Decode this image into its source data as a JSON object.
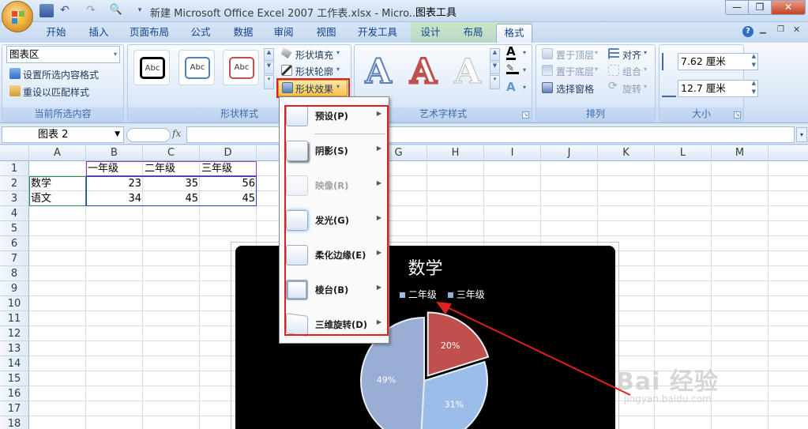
{
  "window": {
    "title": "新建 Microsoft Office Excel 2007 工作表.xlsx - Micro...",
    "context_label": "图表工具",
    "min": "—",
    "restore": "❐",
    "close": "✕"
  },
  "tabs": [
    "开始",
    "插入",
    "页面布局",
    "公式",
    "数据",
    "审阅",
    "视图",
    "开发工具",
    "设计",
    "布局",
    "格式"
  ],
  "active_tab": "格式",
  "ribbon": {
    "current_selection": {
      "dropdown_value": "图表区",
      "format_selection": "设置所选内容格式",
      "reset_style": "重设以匹配样式",
      "label": "当前所选内容"
    },
    "shape_styles": {
      "swatch_text": "Abc",
      "fill": "形状填充",
      "outline": "形状轮廓",
      "effects": "形状效果",
      "label": "形状样式",
      "swatch_colors": [
        "#000000",
        "#4f81bd",
        "#c0504d"
      ]
    },
    "wordart": {
      "glyph": "A",
      "label": "艺术字样式"
    },
    "arrange": {
      "bring_front": "置于顶层",
      "send_back": "置于底层",
      "selection_pane": "选择窗格",
      "align": "对齐",
      "group": "组合",
      "rotate": "旋转",
      "label": "排列"
    },
    "size": {
      "height": "7.62 厘米",
      "width": "12.7 厘米",
      "label": "大小"
    }
  },
  "formula_bar": {
    "name_box": "图表 2",
    "fx": "fx"
  },
  "sheet": {
    "columns": [
      "A",
      "B",
      "C",
      "D",
      "E",
      "F",
      "G",
      "H",
      "I",
      "J",
      "K",
      "L",
      "M"
    ],
    "rows": [
      "1",
      "2",
      "3",
      "4",
      "5",
      "6",
      "7",
      "8",
      "9",
      "10",
      "11",
      "12",
      "13",
      "14",
      "15",
      "16",
      "17",
      "18"
    ],
    "cells": {
      "B1": "一年级",
      "C1": "二年级",
      "D1": "三年级",
      "A2": "数学",
      "B2": "23",
      "C2": "35",
      "D2": "56",
      "A3": "语文",
      "B3": "34",
      "C3": "45",
      "D3": "45"
    }
  },
  "chart_data": {
    "type": "pie",
    "title": "数学",
    "categories": [
      "一年级",
      "二年级",
      "三年级"
    ],
    "values": [
      23,
      35,
      56
    ],
    "data_labels": [
      "20%",
      "31%",
      "49%"
    ],
    "legend_visible_text": [
      "级",
      "二年级",
      "三年级"
    ],
    "colors": [
      "#c0504d",
      "#9bbdea",
      "#98aed3"
    ],
    "legend": "top"
  },
  "menu": {
    "items": [
      {
        "label": "预设(P)",
        "enabled": true
      },
      {
        "label": "阴影(S)",
        "enabled": true
      },
      {
        "label": "映像(R)",
        "enabled": false
      },
      {
        "label": "发光(G)",
        "enabled": true
      },
      {
        "label": "柔化边缘(E)",
        "enabled": true
      },
      {
        "label": "棱台(B)",
        "enabled": true
      },
      {
        "label": "三维旋转(D)",
        "enabled": true
      }
    ]
  },
  "watermark": {
    "brand": "Bai 经验",
    "url": "jingyan.baidu.com"
  }
}
